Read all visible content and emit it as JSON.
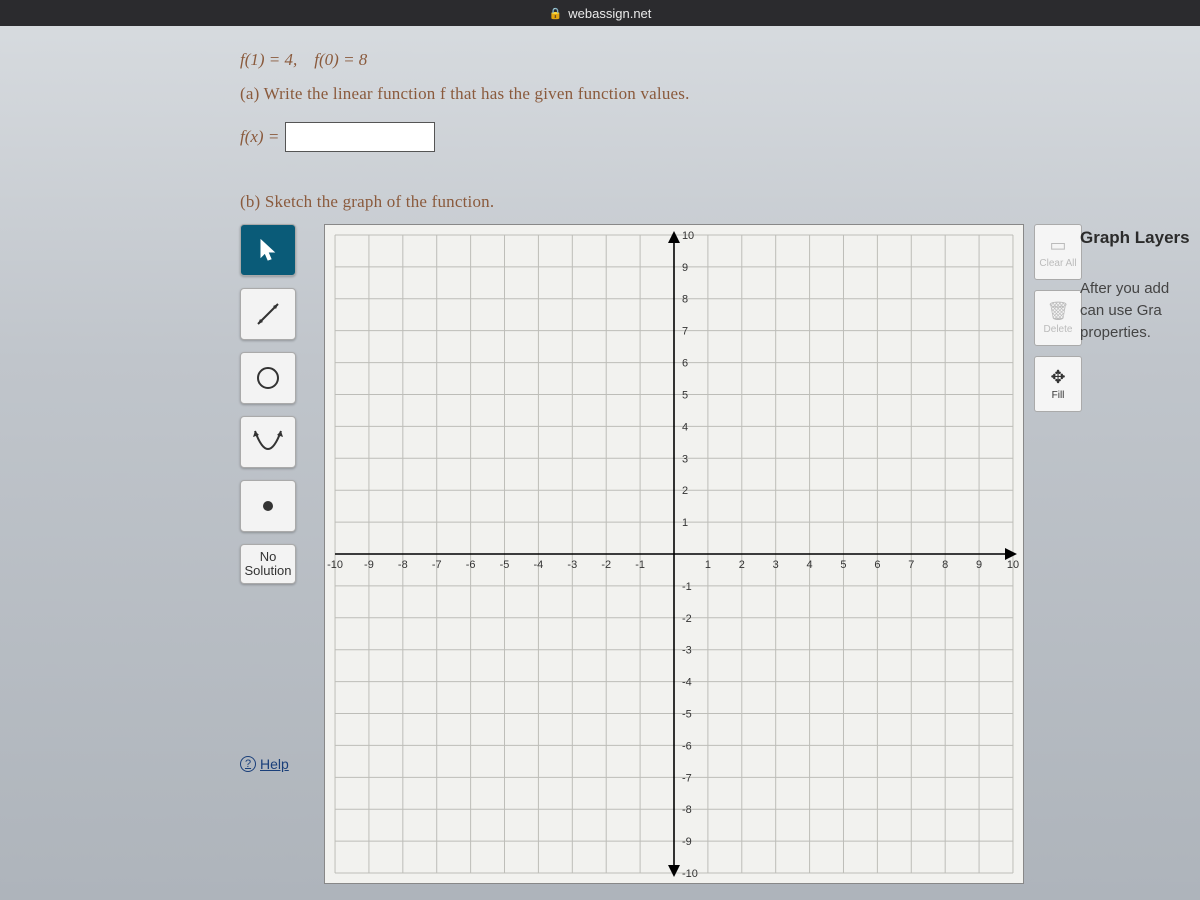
{
  "url_bar": {
    "domain": "webassign.net"
  },
  "problem": {
    "given": "f(1) = 4, f(0) = 8",
    "part_a_prompt": "(a) Write the linear function f that has the given function values.",
    "fx_label": "f(x) =",
    "answer_value": "",
    "part_b_prompt": "(b) Sketch the graph of the function."
  },
  "tools": {
    "pointer": "➤",
    "line": "↗",
    "circle": "◯",
    "parabola": "∪",
    "point": "•",
    "no_solution_line1": "No",
    "no_solution_line2": "Solution",
    "help": "Help"
  },
  "side_buttons": {
    "clear": "Clear All",
    "delete": "Delete",
    "fill": "Fill"
  },
  "layers": {
    "title": "Graph Layers",
    "line1": "After you add",
    "line2": "can use Gra",
    "line3": "properties."
  },
  "chart_data": {
    "type": "grid",
    "title": "",
    "xlabel": "",
    "ylabel": "",
    "xlim": [
      -10,
      10
    ],
    "ylim": [
      -10,
      10
    ],
    "x_ticks": [
      -10,
      -9,
      -8,
      -7,
      -6,
      -5,
      -4,
      -3,
      -2,
      -1,
      1,
      2,
      3,
      4,
      5,
      6,
      7,
      8,
      9,
      10
    ],
    "y_ticks": [
      10,
      9,
      8,
      7,
      6,
      5,
      4,
      3,
      2,
      1,
      -1,
      -2,
      -3,
      -4,
      -5,
      -6,
      -7,
      -8,
      -9,
      -10
    ],
    "series": []
  }
}
